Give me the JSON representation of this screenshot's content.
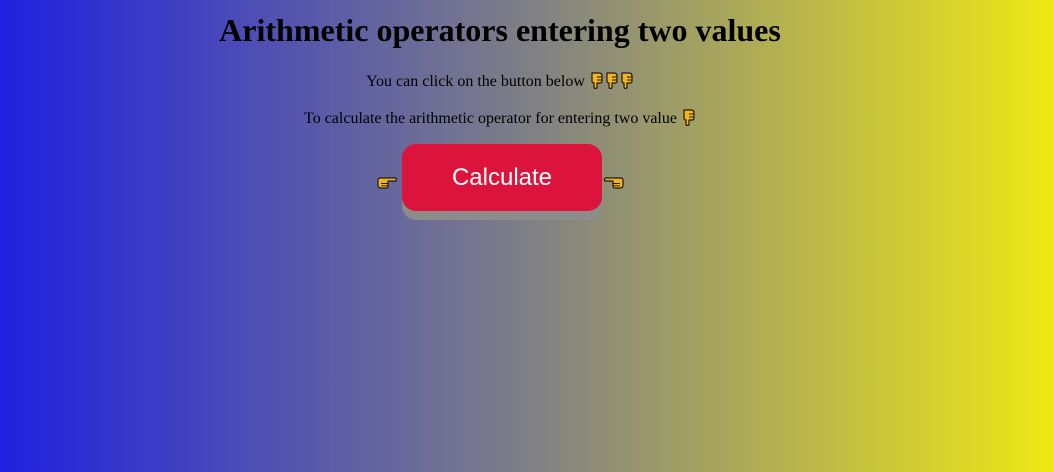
{
  "header": {
    "title": "Arithmetic operators entering two values"
  },
  "instructions": {
    "line1": "You can click on the button below",
    "line1_icons": [
      "pointing-down-icon",
      "pointing-down-icon",
      "pointing-down-icon"
    ],
    "line2": "To calculate the arithmetic operator for entering two value",
    "line2_icons": [
      "pointing-down-icon"
    ]
  },
  "action": {
    "calculate_label": "Calculate",
    "left_icon": "pointing-right-icon",
    "right_icon": "pointing-left-icon"
  },
  "colors": {
    "gradient_start": "#2020e0",
    "gradient_mid": "#7f7f86",
    "gradient_end": "#ede815",
    "button": "#dc143c",
    "button_shadow": "#8c8c8c",
    "emoji_fill": "#f5b41e"
  }
}
